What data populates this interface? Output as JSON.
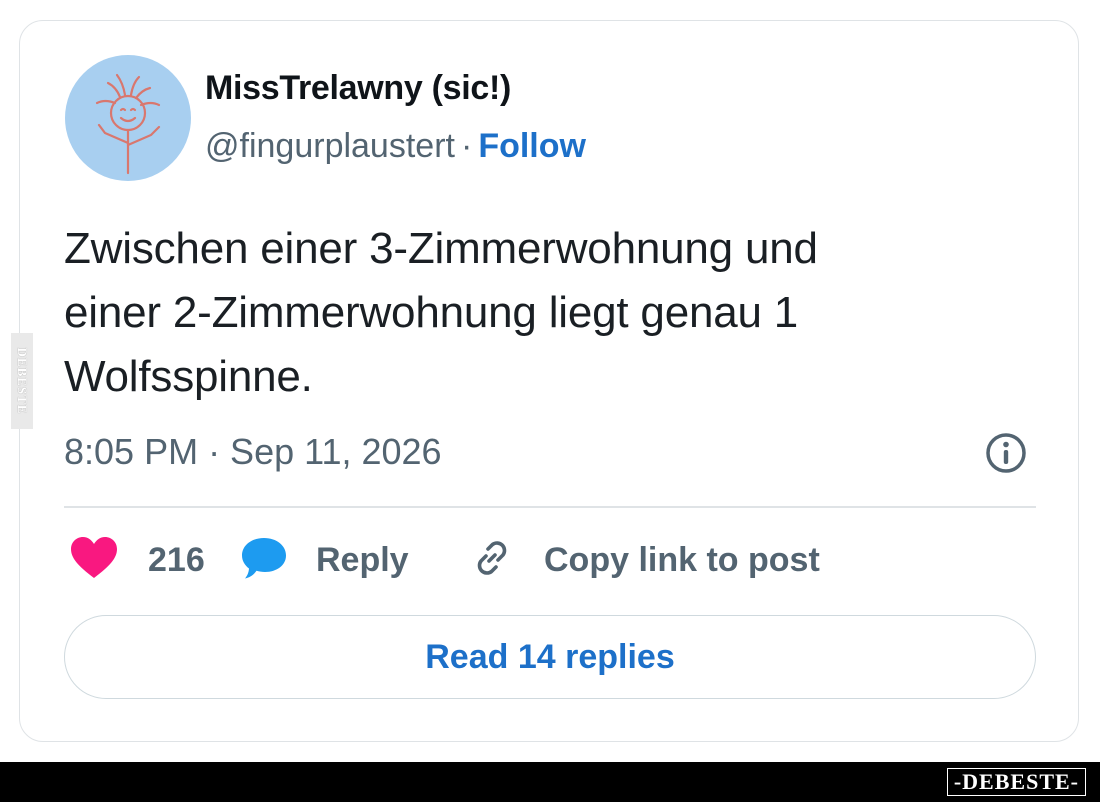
{
  "tweet": {
    "author_name": "MissTrelawny (sic!)",
    "handle": "@fingurplaustert",
    "separator": "·",
    "follow_label": "Follow",
    "text_lines": [
      "Zwischen einer 3-Zimmerwohnung und",
      "einer 2-Zimmerwohnung liegt genau 1",
      "Wolfsspinne."
    ],
    "timestamp": "8:05 PM · Sep 11, 2026",
    "like_count": "216",
    "reply_label": "Reply",
    "copy_link_label": "Copy link to post",
    "read_replies_label": "Read 14 replies"
  },
  "icons": {
    "like": "heart-icon",
    "reply": "speech-bubble-icon",
    "copy": "link-icon",
    "info": "info-circle-icon"
  },
  "colors": {
    "link_blue": "#1d70c9",
    "heart_pink": "#f91880",
    "reply_blue": "#1d9bf0",
    "secondary_text": "#536471",
    "avatar_bg": "#a8cff0"
  },
  "watermark": {
    "side_text": "DEBESTE",
    "logo_text": "-DEBESTE-"
  }
}
